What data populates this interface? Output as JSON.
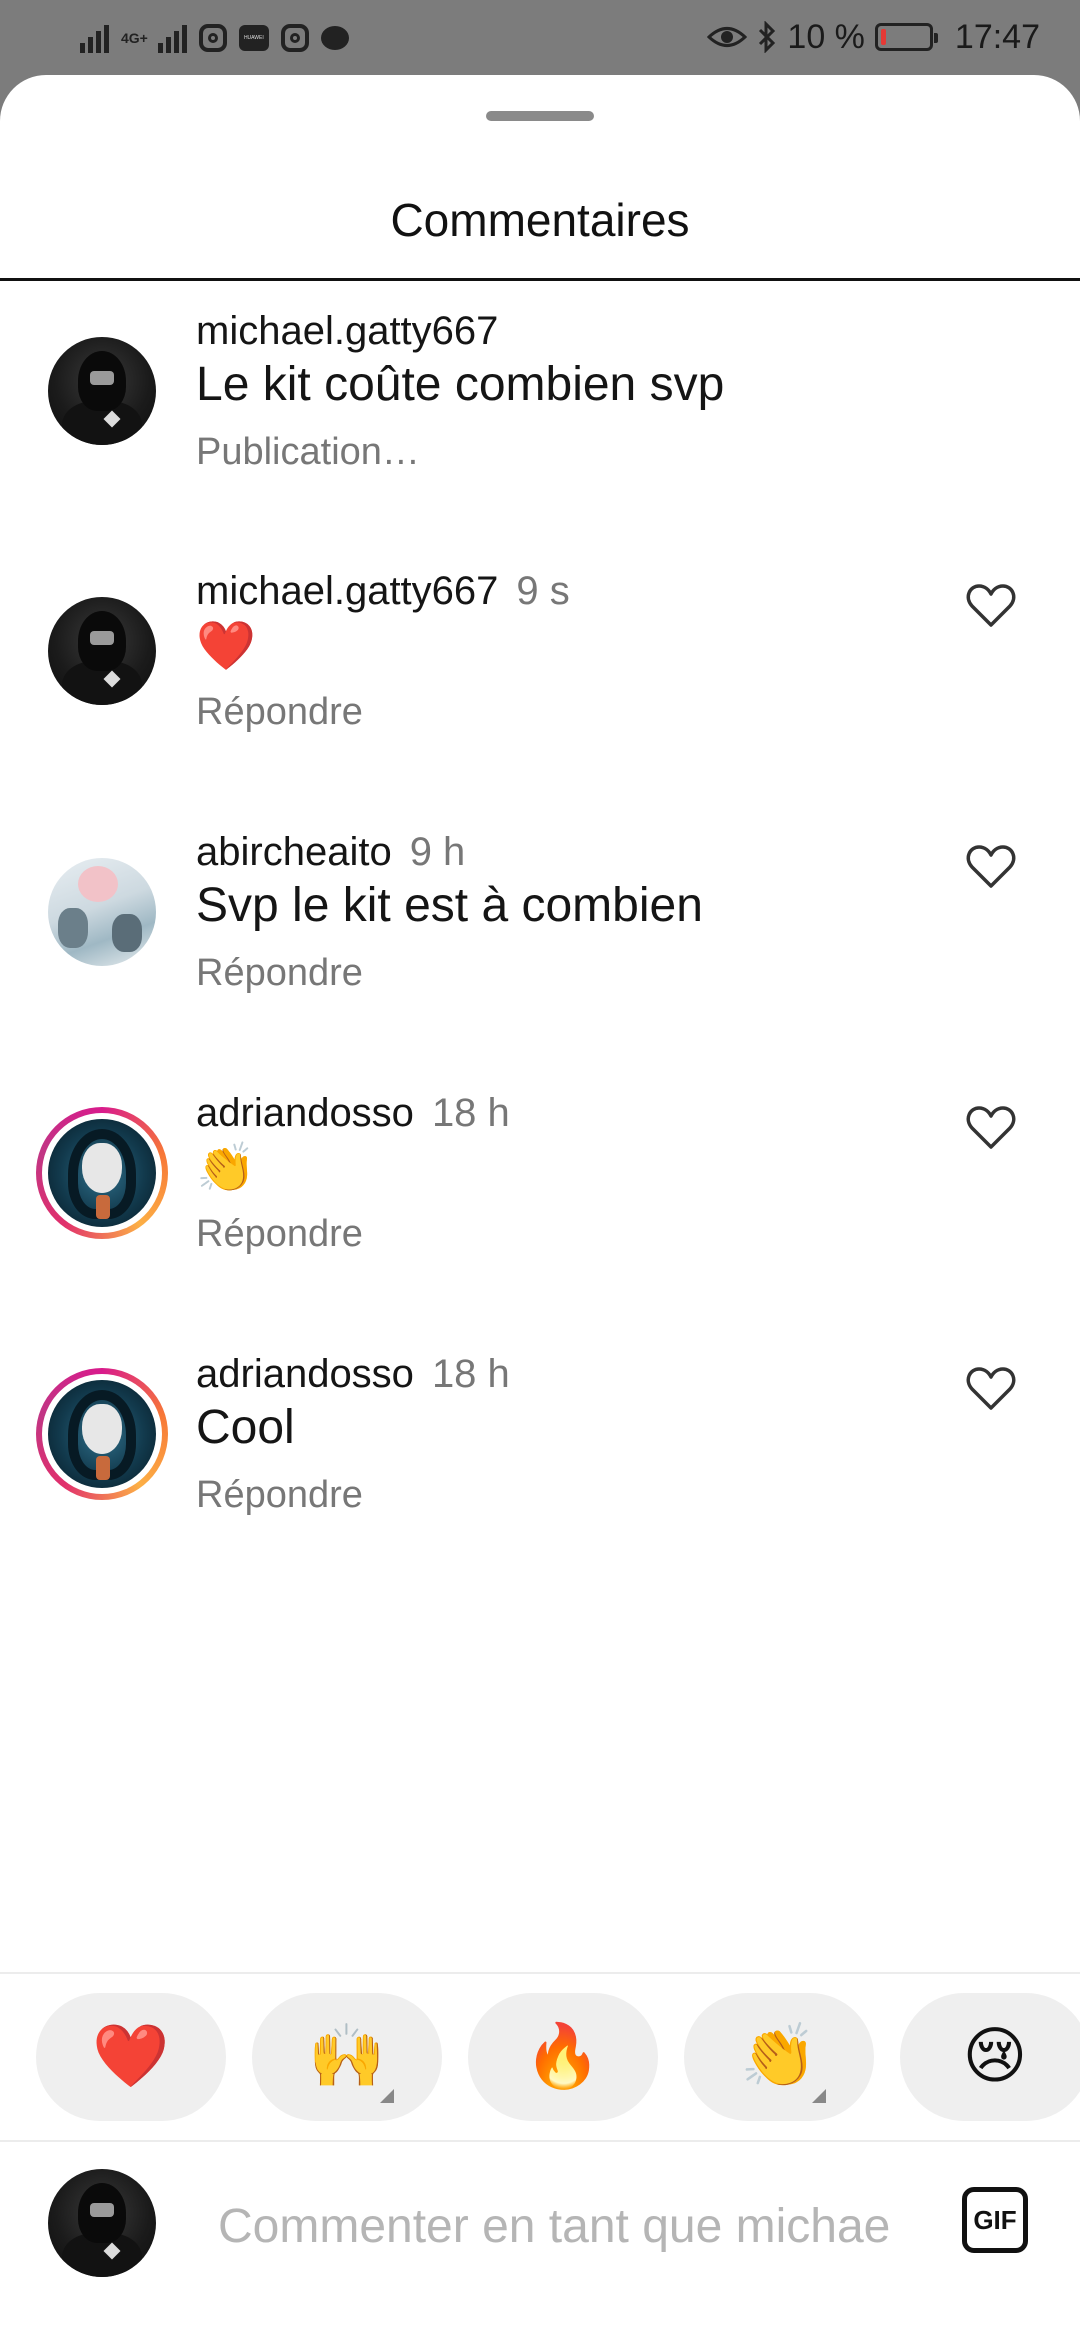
{
  "status_bar": {
    "network_label": "4G+",
    "battery": "10 %",
    "battery_level": 0.1,
    "time": "17:47",
    "huawei_label": "HUAWEI"
  },
  "sheet": {
    "title": "Commentaires"
  },
  "comments": [
    {
      "username": "michael.gatty667",
      "time": "",
      "text": "Le kit coûte combien svp",
      "action": "Publication…"
    },
    {
      "username": "michael.gatty667",
      "time": "9 s",
      "text": "❤️",
      "action": "Répondre"
    },
    {
      "username": "abircheaito",
      "time": "9 h",
      "text": "Svp le kit est à combien",
      "action": "Répondre"
    },
    {
      "username": "adriandosso",
      "time": "18 h",
      "text": "👏",
      "action": "Répondre"
    },
    {
      "username": "adriandosso",
      "time": "18 h",
      "text": "Cool",
      "action": "Répondre"
    }
  ],
  "reactions": [
    "❤️",
    "🙌",
    "🔥",
    "👏",
    "😢"
  ],
  "composer": {
    "placeholder": "Commenter en tant que michae",
    "gif_label": "GIF"
  },
  "colors": {
    "heart": "#e8202c",
    "muted_text": "#777777",
    "story_ring": "#d81b8c"
  }
}
